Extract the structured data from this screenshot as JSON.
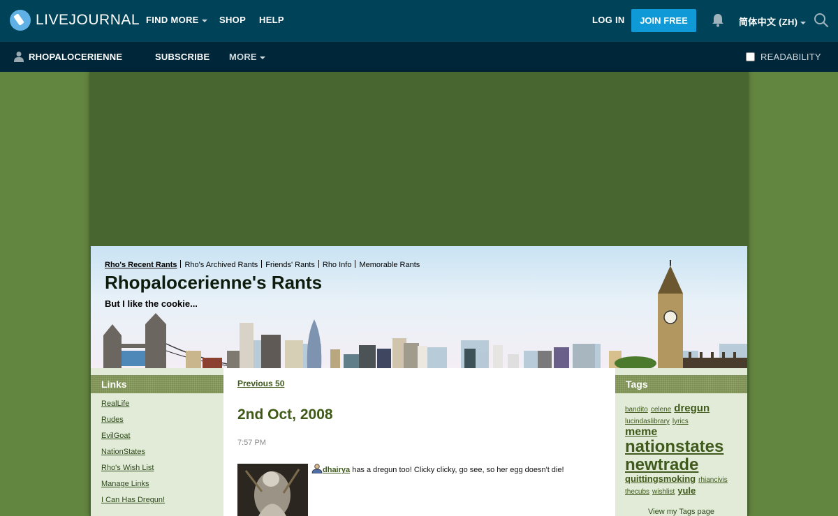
{
  "topbar": {
    "logo_text": "LIVEJOURNAL",
    "nav": [
      {
        "label": "FIND MORE",
        "has_caret": true
      },
      {
        "label": "SHOP",
        "has_caret": false
      },
      {
        "label": "HELP",
        "has_caret": false
      }
    ],
    "login_label": "LOG IN",
    "join_label": "JOIN FREE",
    "language_label": "简体中文 (ZH)",
    "icons": [
      "livejournal-logo-icon",
      "bell-icon",
      "search-icon"
    ]
  },
  "subbar": {
    "username": "RHOPALOCERIENNE",
    "subscribe_label": "SUBSCRIBE",
    "more_label": "MORE",
    "readability_label": "READABILITY"
  },
  "header": {
    "nav": [
      "Rho's Recent Rants",
      "Rho's Archived Rants",
      "Friends' Rants",
      "Rho Info",
      "Memorable Rants"
    ],
    "title": "Rhopalocerienne's Rants",
    "subtitle": "But I like the cookie..."
  },
  "links": {
    "title": "Links",
    "items": [
      "RealLife",
      "Rudes",
      "EvilGoat",
      "NationStates",
      "Rho's Wish List",
      "Manage Links",
      "I Can Has Dregun!"
    ]
  },
  "main": {
    "prev_label": "Previous 50",
    "post": {
      "date": "2nd Oct, 2008",
      "time": "7:57 PM",
      "user": "dhairya",
      "text": " has a dregun too! Clicky clicky, go see, so her egg doesn't die!"
    }
  },
  "tags": {
    "title": "Tags",
    "items": [
      "bandito",
      "celene",
      "dregun",
      "lucindaslibrary",
      "lyrics",
      "meme",
      "nationstates",
      "newtrade",
      "quittingsmoking",
      "rhiancivis",
      "thecubs",
      "wishlist",
      "yule"
    ],
    "view_label": "View my Tags page"
  },
  "colors": {
    "topbar": "#004359",
    "subbar": "#00263a",
    "join_button": "#0f9ad7",
    "page_bg": "#628540",
    "accent_green": "#3f5a1c"
  }
}
